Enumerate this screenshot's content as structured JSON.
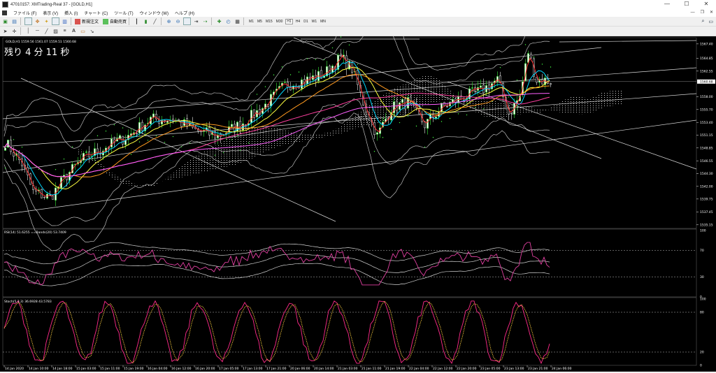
{
  "window": {
    "title": "47010157: XMTrading-Real 37 - [GOLD,H1]"
  },
  "window_controls": [
    "—",
    "☐",
    "✕"
  ],
  "menu": {
    "items": [
      "ファイル (F)",
      "表示 (V)",
      "挿入 (I)",
      "チャート (C)",
      "ツール (T)",
      "ウィンドウ (W)",
      "ヘルプ (H)"
    ],
    "mdi_controls": [
      "—",
      "❐",
      "✕"
    ]
  },
  "toolbar": {
    "new_order": "新規注文",
    "auto_trading": "自動売買",
    "timeframes": [
      "M1",
      "M5",
      "M15",
      "M30",
      "H1",
      "H4",
      "D1",
      "W1",
      "MN"
    ],
    "active_timeframe": "H1"
  },
  "chart": {
    "header": "GOLD,H1  1559.56 1561.07 1559.51 1560.68",
    "countdown": "残り 4 分 11 秒",
    "current_price": "1560.68",
    "price_ticks": [
      {
        "label": "1567.40",
        "value": 1567.4
      },
      {
        "label": "1564.85",
        "value": 1564.85
      },
      {
        "label": "1562.55",
        "value": 1562.55
      },
      {
        "label": "1558.00",
        "value": 1558.0
      },
      {
        "label": "1555.70",
        "value": 1555.7
      },
      {
        "label": "1553.40",
        "value": 1553.4
      },
      {
        "label": "1551.15",
        "value": 1551.15
      },
      {
        "label": "1548.85",
        "value": 1548.85
      },
      {
        "label": "1546.55",
        "value": 1546.55
      },
      {
        "label": "1544.30",
        "value": 1544.3
      },
      {
        "label": "1542.00",
        "value": 1542.0
      },
      {
        "label": "1539.75",
        "value": 1539.75
      },
      {
        "label": "1537.45",
        "value": 1537.45
      },
      {
        "label": "1535.15",
        "value": 1535.15
      }
    ],
    "time_labels": [
      "14 Jan 2020",
      "14 Jan 10:00",
      "14 Jan 18:00",
      "15 Jan 03:00",
      "15 Jan 11:00",
      "15 Jan 19:00",
      "16 Jan 04:00",
      "16 Jan 12:00",
      "16 Jan 20:00",
      "17 Jan 05:00",
      "17 Jan 13:00",
      "17 Jan 21:00",
      "20 Jan 06:00",
      "20 Jan 14:00",
      "21 Jan 03:00",
      "21 Jan 11:00",
      "21 Jan 19:00",
      "22 Jan 04:00",
      "22 Jan 12:00",
      "22 Jan 20:00",
      "23 Jan 05:00",
      "23 Jan 13:00",
      "23 Jan 21:00",
      "24 Jan 06:00"
    ]
  },
  "rsi_panel": {
    "header": "RSI(14) 51.6255  ==Bands(20) 53.7409",
    "levels": [
      {
        "label": "100",
        "value": 100
      },
      {
        "label": "70",
        "value": 70
      },
      {
        "label": "30",
        "value": 30
      },
      {
        "label": "0",
        "value": 0
      }
    ]
  },
  "stoch_panel": {
    "header": "Stoch(5,3,3) 36.6928 43.5783",
    "levels": [
      {
        "label": "100",
        "value": 100
      },
      {
        "label": "80",
        "value": 80
      },
      {
        "label": "20",
        "value": 20
      },
      {
        "label": "0",
        "value": 0
      }
    ]
  },
  "colors": {
    "bull_candle": "#33cc33",
    "ma_red": "#ff3030",
    "ma_cyan": "#00d8ff",
    "ma_yellow": "#ffff40",
    "ma_orange": "#ff9a20",
    "ma_pink": "#ff40a0",
    "ma_magenta": "#ff60ff",
    "stoch_main": "#ff2a8a",
    "stoch_signal": "#ffd040"
  }
}
